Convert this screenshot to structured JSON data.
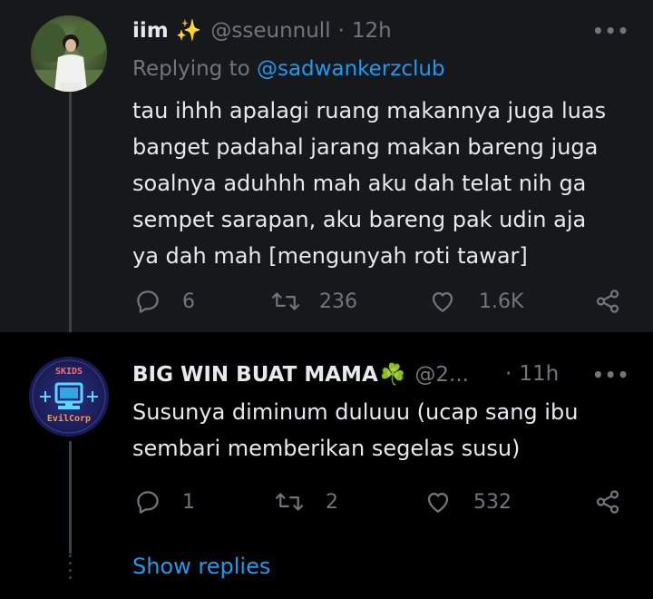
{
  "tweets": [
    {
      "name": "iim",
      "name_emoji": "✨",
      "handle": "@sseunnull",
      "separator": "·",
      "time": "12h",
      "replying_prefix": "Replying to",
      "replying_to": "@sadwankerzclub",
      "text_lines": [
        "tau ihhh apalagi ruang makannya juga luas",
        "banget padahal jarang makan bareng juga",
        "soalnya aduhhh mah aku dah telat nih ga",
        "sempet sarapan, aku bareng pak udin aja",
        "ya dah mah [mengunyah roti tawar]"
      ],
      "replies": "6",
      "retweets": "236",
      "likes": "1.6K",
      "more_icon": "more-icon"
    },
    {
      "name": "BIG WIN BUAT MAMA",
      "name_emoji": "☘️",
      "handle": "@2...",
      "separator": "·",
      "time": "11h",
      "avatar_top_text": "SKIDS",
      "avatar_bottom_text": "EvilCorp",
      "text_lines": [
        "Susunya diminum duluuu (ucap sang ibu",
        "sembari memberikan segelas susu)"
      ],
      "replies": "1",
      "retweets": "2",
      "likes": "532",
      "more_icon": "more-icon"
    }
  ],
  "show_replies_label": "Show replies",
  "colors": {
    "background_top": "#16181c",
    "background": "#000000",
    "text": "#e7e9ea",
    "muted": "#71767b",
    "accent": "#1d9bf0"
  }
}
